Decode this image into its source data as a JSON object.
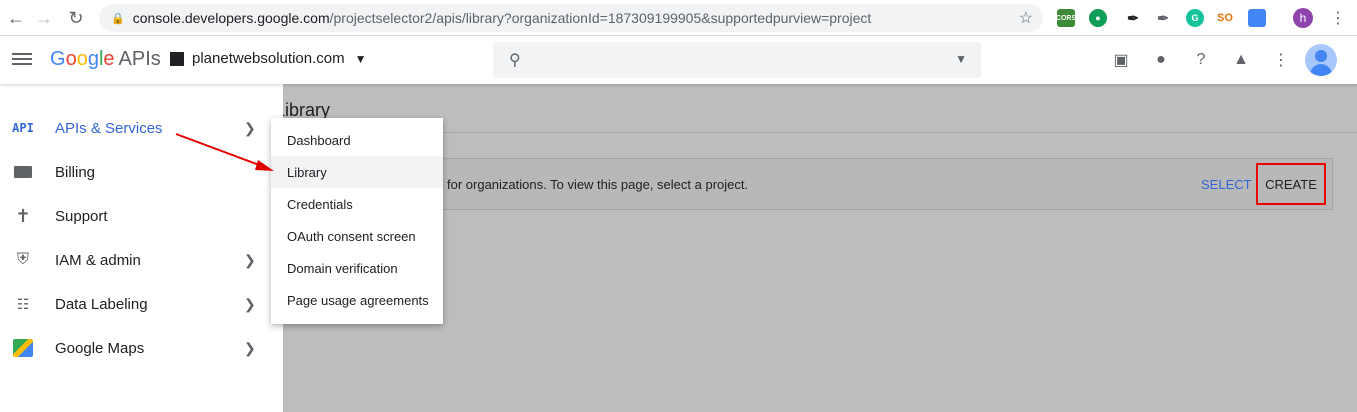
{
  "browser": {
    "url_host": "console.developers.google.com",
    "url_path": "/projectselector2/apis/library?organizationId=187309199905&supportedpurview=project",
    "profile_initial": "h",
    "extensions": [
      {
        "name": "cors-icon",
        "label": "CORS",
        "color": "#3d8b37"
      },
      {
        "name": "green-ext-icon",
        "label": "",
        "color": "#0f9d58"
      },
      {
        "name": "eyedropper-icon",
        "label": "",
        "color": "#202124"
      },
      {
        "name": "colorpicker-icon",
        "label": "",
        "color": "#5f6368"
      },
      {
        "name": "grammarly-icon",
        "label": "G",
        "color": "#15c39a"
      },
      {
        "name": "seo-icon",
        "label": "SO",
        "color": "#e8710a"
      },
      {
        "name": "screenshot-icon",
        "label": "",
        "color": "#4285f4"
      }
    ]
  },
  "header": {
    "logo_google": "Google",
    "logo_apis": "APIs",
    "org_name": "planetwebsolution.com"
  },
  "main": {
    "page_title": "Library",
    "banner_text": "for organizations. To view this page, select a project.",
    "select_label": "SELECT",
    "create_label": "CREATE"
  },
  "drawer": {
    "items": [
      {
        "label": "APIs & Services",
        "icon": "API",
        "active": true,
        "has_submenu": true
      },
      {
        "label": "Billing",
        "icon": "billing-icon",
        "has_submenu": false
      },
      {
        "label": "Support",
        "icon": "support-icon",
        "has_submenu": false
      },
      {
        "label": "IAM & admin",
        "icon": "shield-icon",
        "has_submenu": true
      },
      {
        "label": "Data Labeling",
        "icon": "data-labeling-icon",
        "has_submenu": true
      },
      {
        "label": "Google Maps",
        "icon": "maps-icon",
        "has_submenu": true
      }
    ]
  },
  "submenu": {
    "items": [
      "Dashboard",
      "Library",
      "Credentials",
      "OAuth consent screen",
      "Domain verification",
      "Page usage agreements"
    ],
    "hovered": "Library"
  },
  "colors": {
    "accent": "#3367d6",
    "annotation": "#e00000"
  }
}
